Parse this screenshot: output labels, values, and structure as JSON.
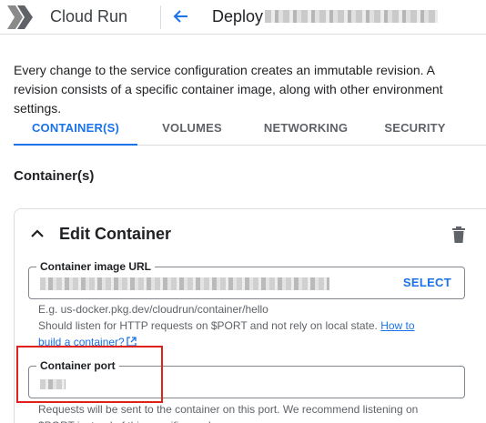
{
  "header": {
    "logo_icon": "cloud-run-logo",
    "app_name": "Cloud Run",
    "back_icon": "arrow-back-icon",
    "page_title": "Deploy"
  },
  "description": "Every change to the service configuration creates an immutable revision. A revision consists of a specific container image, along with other environment settings.",
  "tabs": [
    {
      "label": "CONTAINER(S)",
      "active": true
    },
    {
      "label": "VOLUMES",
      "active": false
    },
    {
      "label": "NETWORKING",
      "active": false
    },
    {
      "label": "SECURITY",
      "active": false
    }
  ],
  "section_title": "Container(s)",
  "container": {
    "title": "Edit Container",
    "image_url": {
      "label": "Container image URL",
      "select_label": "SELECT",
      "hint_example": "E.g. us-docker.pkg.dev/cloudrun/container/hello",
      "hint_text": "Should listen for HTTP requests on $PORT and not rely on local state.",
      "hint_link": "How to build a container?"
    },
    "port": {
      "label": "Container port",
      "hint": "Requests will be sent to the container on this port. We recommend listening on $PORT instead of this specific number."
    }
  },
  "colors": {
    "accent": "#1a73e8",
    "highlight": "#e0201b"
  }
}
